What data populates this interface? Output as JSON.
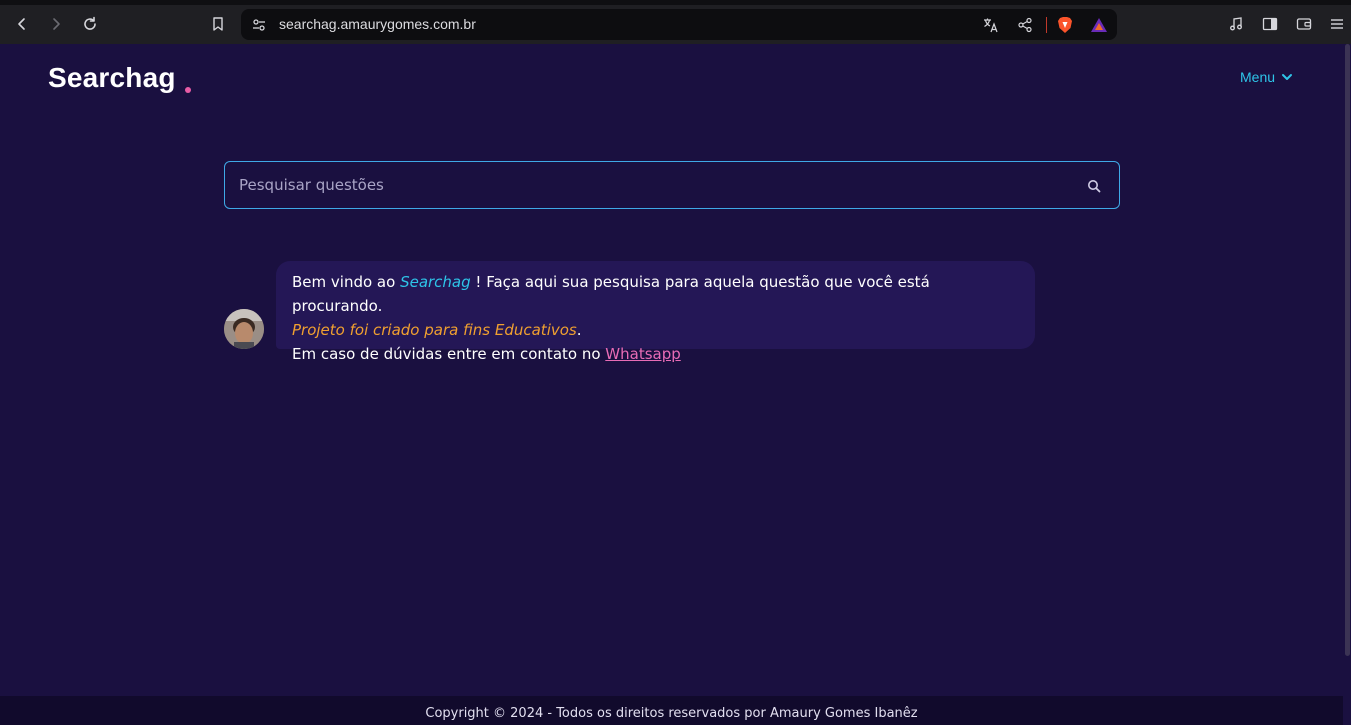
{
  "browser": {
    "url": "searchag.amaurygomes.com.br",
    "icons": [
      "back-icon",
      "forward-icon",
      "reload-icon",
      "bookmark-icon",
      "site-settings-icon",
      "translate-icon",
      "share-icon",
      "brave-shields-icon",
      "brave-rewards-icon",
      "media-icon",
      "sidebar-icon",
      "wallet-icon",
      "hamburger-menu-icon"
    ]
  },
  "header": {
    "logo": "Searchag",
    "menu_label": "Menu"
  },
  "search": {
    "placeholder": "Pesquisar questões"
  },
  "message": {
    "line1_prefix": "Bem vindo ao ",
    "line1_brand": "Searchag",
    "line1_suffix": " ! Faça aqui sua pesquisa para aquela questão que você está procurando.",
    "line2_italic": "Projeto foi criado para fins Educativos",
    "line2_suffix": ".",
    "line3_prefix": "Em caso de dúvidas entre em contato no ",
    "line3_link": "Whatsapp"
  },
  "footer": {
    "text": "Copyright © 2024 - Todos os direitos reservados por Amaury Gomes Ibanêz"
  },
  "colors": {
    "background": "#1a1040",
    "accent_cyan": "#2ec4e8",
    "accent_pink": "#e85ca6",
    "accent_orange": "#f0a030",
    "bubble": "#241756"
  }
}
